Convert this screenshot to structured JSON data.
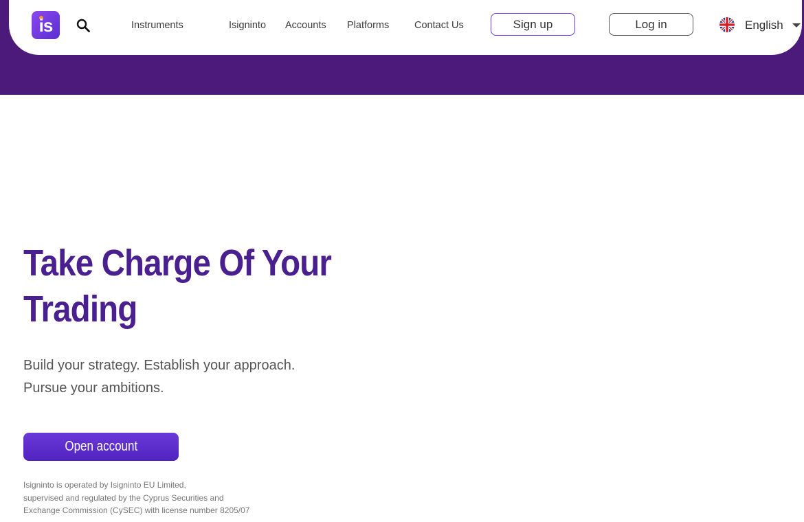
{
  "brand": {
    "logo_text": "is",
    "colors": {
      "primary": "#4c1a7a",
      "accent": "#6a3ad8",
      "logo_dot": "#ff9a1f"
    }
  },
  "nav": {
    "links": [
      "Instruments",
      "Isigninto",
      "Accounts",
      "Platforms",
      "Contact Us"
    ],
    "signup_label": "Sign up",
    "login_label": "Log in",
    "language": "English",
    "icons": {
      "search": "search-icon",
      "flag": "uk-flag-icon",
      "caret": "chevron-down-icon"
    }
  },
  "hero": {
    "title_line1": "Take Charge Of Your",
    "title_line2": "Trading",
    "subtitle_line1": "Build your strategy. Establish your approach.",
    "subtitle_line2": "Pursue your ambitions.",
    "cta_label": "Open account",
    "disclaimer_lines": [
      "Isigninto is operated by Isigninto EU Limited,",
      "supervised and regulated by the Cyprus Securities and",
      "Exchange Commission (CySEC) with license number 8205/07"
    ]
  }
}
